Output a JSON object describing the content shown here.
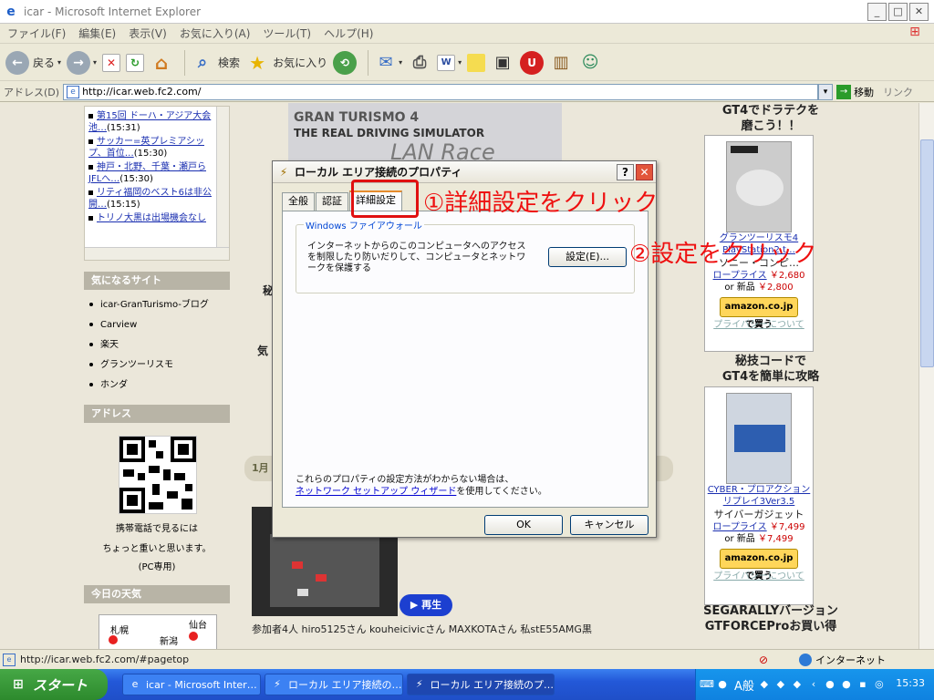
{
  "window": {
    "title": "icar - Microsoft Internet Explorer",
    "minimize": "_",
    "maximize": "□",
    "close": "✕"
  },
  "menu": [
    "ファイル(F)",
    "編集(E)",
    "表示(V)",
    "お気に入り(A)",
    "ツール(T)",
    "ヘルプ(H)"
  ],
  "toolbar": {
    "back_label": "戻る",
    "search_label": "検索",
    "favorites_label": "お気に入り"
  },
  "address": {
    "label": "アドレス(D)",
    "value": "http://icar.web.fc2.com/",
    "go_label": "移動",
    "links_label": "リンク"
  },
  "left": {
    "news": [
      {
        "link": "第15回 ドーハ・アジア大会 池…",
        "time": "(15:31)"
      },
      {
        "link": "サッカー=英プレミアシップ、首位…",
        "time": "(15:30)"
      },
      {
        "link": "神戸・北野、千葉・瀬戸らJFLへ…",
        "time": "(15:30)"
      },
      {
        "link": "リティ福岡のベスト6は非公開…",
        "time": "(15:15)"
      },
      {
        "link": "トリノ大黒は出場機会なし",
        "time": ""
      }
    ],
    "sites_heading": "気になるサイト",
    "sites": [
      "icar-GranTurismo-ブログ",
      "Carview",
      "楽天",
      "グランツーリスモ",
      "ホンダ"
    ],
    "address_heading": "アドレス",
    "qr_note_1": "携帯電話で見るには",
    "qr_note_2": "ちょっと重いと思います。",
    "qr_note_3": "(PC専用)",
    "weather_heading": "今日の天気",
    "weather_cities": [
      "札幌",
      "仙台",
      "新潟"
    ]
  },
  "center": {
    "banner_line1": "GRAN TURISMO 4",
    "banner_line2": "THE REAL DRIVING SIMULATOR",
    "banner_line3": "LAN Race",
    "frag_1": "秘",
    "frag_2": "気",
    "date_pill": "1月",
    "play_label": "▶ 再生",
    "participants": "参加者4人  hiro5125さん kouheicivicさん MAXKOTAさん 私stE55AMG黒"
  },
  "right": {
    "head1_line1": "GT4でドラテクを",
    "head1_line2": "磨こう！！",
    "prod1_link_1": "グランツーリスモ4",
    "prod1_link_2": "PlayStation2 t…",
    "prod1_maker": "ソニー・コンピ…",
    "prod1_price_label": "ロープライス",
    "prod1_price": "￥2,680",
    "prod1_new_label": "or 新品",
    "prod1_new_price": "￥2,800",
    "amazon_label": "amazon.co.jp で買う",
    "privacy": "プライバシーについて",
    "head2_line1": "秘技コードで",
    "head2_line2": "GT4を簡単に攻略",
    "prod2_link_1": "CYBER・プロアクション",
    "prod2_link_2": "リプレイ3Ver3.5",
    "prod2_maker": "サイバーガジェット",
    "prod2_price_label": "ロープライス",
    "prod2_price": "￥7,499",
    "prod2_new_label": "or 新品",
    "prod2_new_price": "￥7,499",
    "head3_line1": "SEGARALLYバージョン",
    "head3_line2": "GTFORCEProお買い得"
  },
  "dialog": {
    "title": "ローカル エリア接続のプロパティ",
    "help": "?",
    "close": "✕",
    "tabs": [
      "全般",
      "認証",
      "詳細設定"
    ],
    "group_legend": "Windows ファイアウォール",
    "group_desc": "インターネットからのこのコンピュータへのアクセスを制限したり防いだりして、コンピュータとネットワークを保護する",
    "settings_button": "設定(E)...",
    "help_text_1": "これらのプロパティの設定方法がわからない場合は、",
    "help_link": "ネットワーク セットアップ ウィザード",
    "help_text_2": "を使用してください。",
    "ok": "OK",
    "cancel": "キャンセル"
  },
  "annotations": {
    "step1": "①詳細設定をクリック",
    "step2": "②設定をクリック"
  },
  "status": {
    "url": "http://icar.web.fc2.com/#pagetop",
    "zone": "インターネット"
  },
  "taskbar": {
    "start": "スタート",
    "tasks": [
      "icar - Microsoft Inter…",
      "ローカル エリア接続の…",
      "ローカル エリア接続のプ…"
    ],
    "ime": "A般",
    "clock": "15:33"
  }
}
